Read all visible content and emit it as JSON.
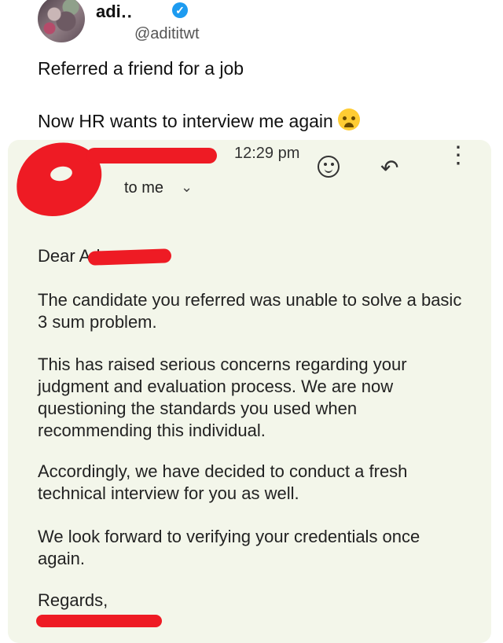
{
  "tweet": {
    "author_name": "adi‥",
    "handle": "@adititwt",
    "text_line1": "Referred a friend for a job",
    "text_line2": "Now HR wants to interview me again"
  },
  "email": {
    "time": "12:29 pm",
    "to": "to me",
    "greeting": "Dear Ad",
    "paragraph1": "The candidate you referred was unable to solve a basic 3 sum problem.",
    "paragraph2": "This has raised serious concerns regarding your judgment and evaluation process. We are now questioning the standards you used when recommending this individual.",
    "paragraph3": "Accordingly, we have decided to conduct a fresh technical interview for you as well.",
    "paragraph4": "We look forward to verifying your credentials once again.",
    "signoff": "Regards,"
  },
  "icons": {
    "verified": "verified-badge-icon",
    "crying_emoji": "crying-emoji-icon",
    "reaction": "emoji-reaction-icon",
    "reply": "reply-icon",
    "more": "more-vertical-icon"
  },
  "colors": {
    "verified_blue": "#1d9bf0",
    "email_background": "#f3f6ea",
    "redaction_red": "#ee1b24"
  }
}
